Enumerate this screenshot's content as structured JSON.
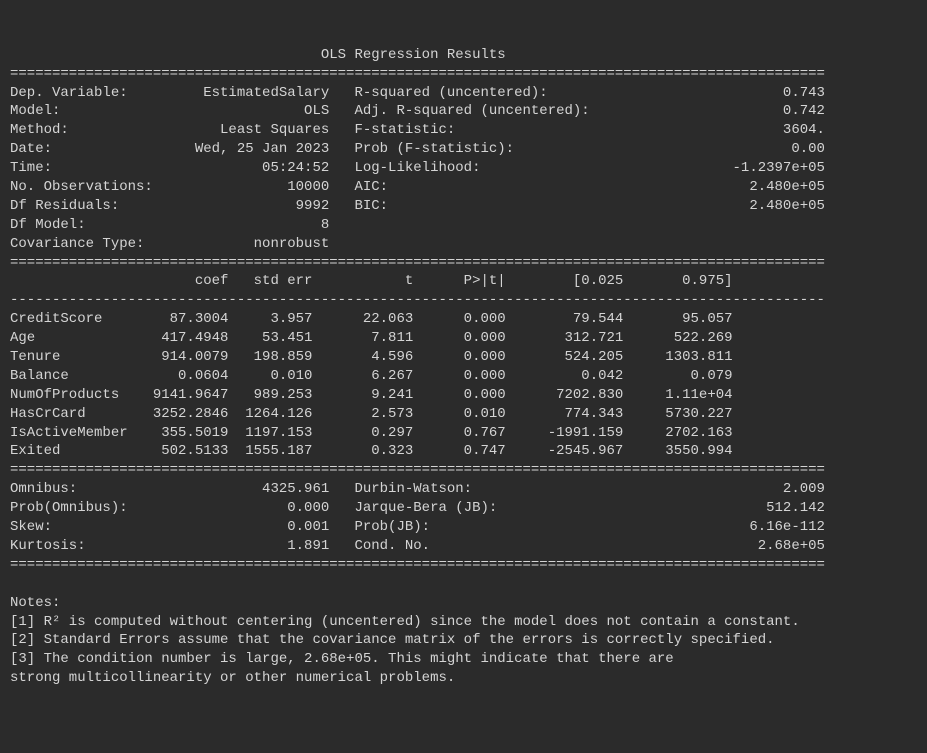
{
  "title": "OLS Regression Results",
  "top_left": [
    {
      "label": "Dep. Variable:",
      "value": "EstimatedSalary"
    },
    {
      "label": "Model:",
      "value": "OLS"
    },
    {
      "label": "Method:",
      "value": "Least Squares"
    },
    {
      "label": "Date:",
      "value": "Wed, 25 Jan 2023"
    },
    {
      "label": "Time:",
      "value": "05:24:52"
    },
    {
      "label": "No. Observations:",
      "value": "10000"
    },
    {
      "label": "Df Residuals:",
      "value": "9992"
    },
    {
      "label": "Df Model:",
      "value": "8"
    },
    {
      "label": "Covariance Type:",
      "value": "nonrobust"
    }
  ],
  "top_right": [
    {
      "label": "R-squared (uncentered):",
      "value": "0.743"
    },
    {
      "label": "Adj. R-squared (uncentered):",
      "value": "0.742"
    },
    {
      "label": "F-statistic:",
      "value": "3604."
    },
    {
      "label": "Prob (F-statistic):",
      "value": "0.00"
    },
    {
      "label": "Log-Likelihood:",
      "value": "-1.2397e+05"
    },
    {
      "label": "AIC:",
      "value": "2.480e+05"
    },
    {
      "label": "BIC:",
      "value": "2.480e+05"
    }
  ],
  "coef_headers": [
    "",
    "coef",
    "std err",
    "t",
    "P>|t|",
    "[0.025",
    "0.975]"
  ],
  "coef_rows": [
    {
      "name": "CreditScore",
      "coef": "87.3004",
      "stderr": "3.957",
      "t": "22.063",
      "p": "0.000",
      "lo": "79.544",
      "hi": "95.057"
    },
    {
      "name": "Age",
      "coef": "417.4948",
      "stderr": "53.451",
      "t": "7.811",
      "p": "0.000",
      "lo": "312.721",
      "hi": "522.269"
    },
    {
      "name": "Tenure",
      "coef": "914.0079",
      "stderr": "198.859",
      "t": "4.596",
      "p": "0.000",
      "lo": "524.205",
      "hi": "1303.811"
    },
    {
      "name": "Balance",
      "coef": "0.0604",
      "stderr": "0.010",
      "t": "6.267",
      "p": "0.000",
      "lo": "0.042",
      "hi": "0.079"
    },
    {
      "name": "NumOfProducts",
      "coef": "9141.9647",
      "stderr": "989.253",
      "t": "9.241",
      "p": "0.000",
      "lo": "7202.830",
      "hi": "1.11e+04"
    },
    {
      "name": "HasCrCard",
      "coef": "3252.2846",
      "stderr": "1264.126",
      "t": "2.573",
      "p": "0.010",
      "lo": "774.343",
      "hi": "5730.227"
    },
    {
      "name": "IsActiveMember",
      "coef": "355.5019",
      "stderr": "1197.153",
      "t": "0.297",
      "p": "0.767",
      "lo": "-1991.159",
      "hi": "2702.163"
    },
    {
      "name": "Exited",
      "coef": "502.5133",
      "stderr": "1555.187",
      "t": "0.323",
      "p": "0.747",
      "lo": "-2545.967",
      "hi": "3550.994"
    }
  ],
  "bottom_left": [
    {
      "label": "Omnibus:",
      "value": "4325.961"
    },
    {
      "label": "Prob(Omnibus):",
      "value": "0.000"
    },
    {
      "label": "Skew:",
      "value": "0.001"
    },
    {
      "label": "Kurtosis:",
      "value": "1.891"
    }
  ],
  "bottom_right": [
    {
      "label": "Durbin-Watson:",
      "value": "2.009"
    },
    {
      "label": "Jarque-Bera (JB):",
      "value": "512.142"
    },
    {
      "label": "Prob(JB):",
      "value": "6.16e-112"
    },
    {
      "label": "Cond. No.",
      "value": "2.68e+05"
    }
  ],
  "notes_header": "Notes:",
  "notes": [
    "[1] R² is computed without centering (uncentered) since the model does not contain a constant.",
    "[2] Standard Errors assume that the covariance matrix of the errors is correctly specified.",
    "[3] The condition number is large, 2.68e+05. This might indicate that there are",
    "strong multicollinearity or other numerical problems."
  ]
}
